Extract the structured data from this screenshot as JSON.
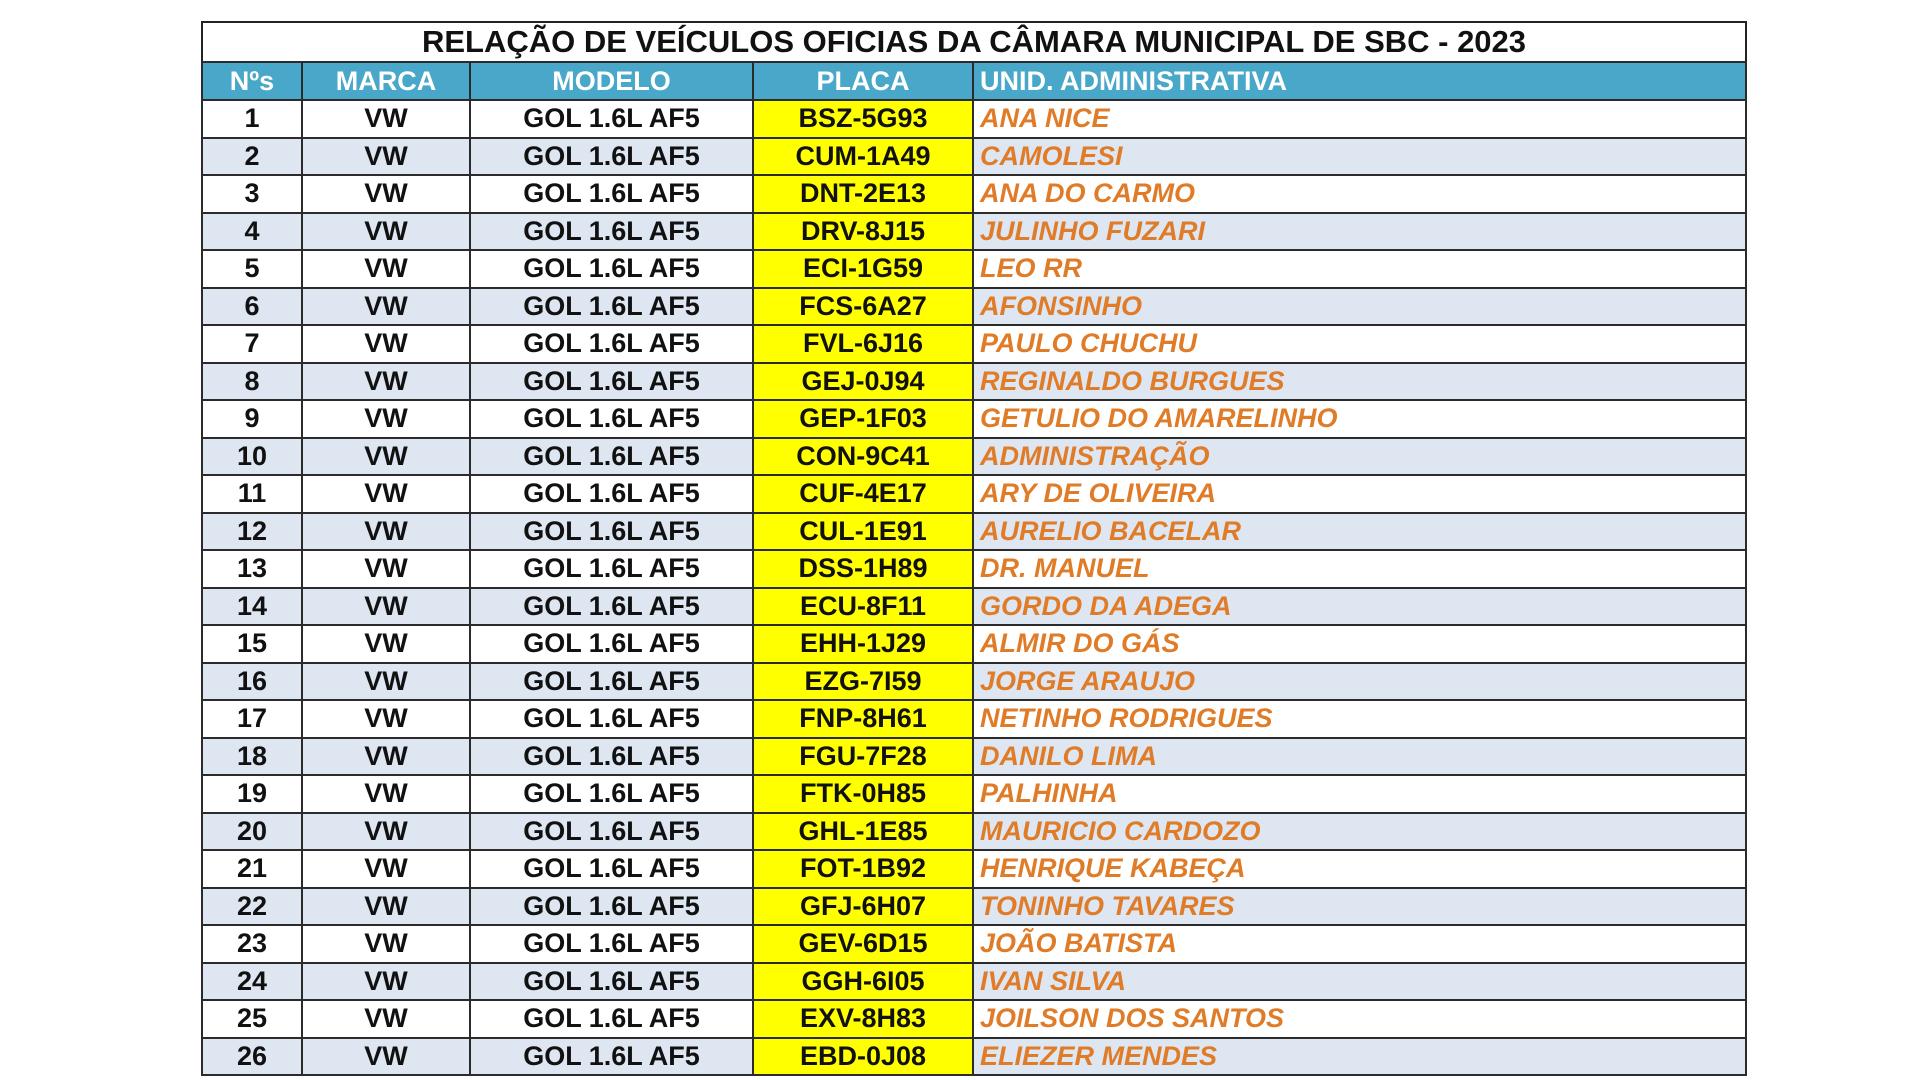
{
  "document": {
    "title": "RELAÇÃO DE VEÍCULOS OFICIAS DA CÂMARA MUNICIPAL DE SBC - 2023"
  },
  "colors": {
    "header_bg": "#49a8c9",
    "header_text": "#ffffff",
    "plate_bg": "#ffff00",
    "unit_text": "#e07b27",
    "alt_row_bg": "#dde6f1",
    "border": "#2b2b2b"
  },
  "table": {
    "columns": [
      "Nºs",
      "MARCA",
      "MODELO",
      "PLACA",
      "UNID. ADMINISTRATIVA"
    ],
    "rows": [
      {
        "num": "1",
        "marca": "VW",
        "modelo": "GOL 1.6L AF5",
        "placa": "BSZ-5G93",
        "unidade": "ANA NICE"
      },
      {
        "num": "2",
        "marca": "VW",
        "modelo": "GOL 1.6L AF5",
        "placa": "CUM-1A49",
        "unidade": "CAMOLESI"
      },
      {
        "num": "3",
        "marca": "VW",
        "modelo": "GOL 1.6L AF5",
        "placa": "DNT-2E13",
        "unidade": "ANA DO CARMO"
      },
      {
        "num": "4",
        "marca": "VW",
        "modelo": "GOL 1.6L AF5",
        "placa": "DRV-8J15",
        "unidade": "JULINHO FUZARI"
      },
      {
        "num": "5",
        "marca": "VW",
        "modelo": "GOL 1.6L AF5",
        "placa": "ECI-1G59",
        "unidade": "LEO RR"
      },
      {
        "num": "6",
        "marca": "VW",
        "modelo": "GOL 1.6L AF5",
        "placa": "FCS-6A27",
        "unidade": "AFONSINHO"
      },
      {
        "num": "7",
        "marca": "VW",
        "modelo": "GOL 1.6L AF5",
        "placa": "FVL-6J16",
        "unidade": "PAULO CHUCHU"
      },
      {
        "num": "8",
        "marca": "VW",
        "modelo": "GOL 1.6L AF5",
        "placa": "GEJ-0J94",
        "unidade": "REGINALDO BURGUES"
      },
      {
        "num": "9",
        "marca": "VW",
        "modelo": "GOL 1.6L AF5",
        "placa": "GEP-1F03",
        "unidade": "GETULIO DO AMARELINHO"
      },
      {
        "num": "10",
        "marca": "VW",
        "modelo": "GOL 1.6L AF5",
        "placa": "CON-9C41",
        "unidade": "ADMINISTRAÇÃO"
      },
      {
        "num": "11",
        "marca": "VW",
        "modelo": "GOL 1.6L AF5",
        "placa": "CUF-4E17",
        "unidade": "ARY DE OLIVEIRA"
      },
      {
        "num": "12",
        "marca": "VW",
        "modelo": "GOL 1.6L AF5",
        "placa": "CUL-1E91",
        "unidade": "AURELIO BACELAR"
      },
      {
        "num": "13",
        "marca": "VW",
        "modelo": "GOL 1.6L AF5",
        "placa": "DSS-1H89",
        "unidade": "DR. MANUEL"
      },
      {
        "num": "14",
        "marca": "VW",
        "modelo": "GOL 1.6L AF5",
        "placa": "ECU-8F11",
        "unidade": "GORDO DA ADEGA"
      },
      {
        "num": "15",
        "marca": "VW",
        "modelo": "GOL 1.6L AF5",
        "placa": "EHH-1J29",
        "unidade": "ALMIR DO GÁS"
      },
      {
        "num": "16",
        "marca": "VW",
        "modelo": "GOL 1.6L AF5",
        "placa": "EZG-7I59",
        "unidade": "JORGE ARAUJO"
      },
      {
        "num": "17",
        "marca": "VW",
        "modelo": "GOL 1.6L AF5",
        "placa": "FNP-8H61",
        "unidade": "NETINHO RODRIGUES"
      },
      {
        "num": "18",
        "marca": "VW",
        "modelo": "GOL 1.6L AF5",
        "placa": "FGU-7F28",
        "unidade": "DANILO LIMA"
      },
      {
        "num": "19",
        "marca": "VW",
        "modelo": "GOL 1.6L AF5",
        "placa": "FTK-0H85",
        "unidade": "PALHINHA"
      },
      {
        "num": "20",
        "marca": "VW",
        "modelo": "GOL 1.6L AF5",
        "placa": "GHL-1E85",
        "unidade": "MAURICIO CARDOZO"
      },
      {
        "num": "21",
        "marca": "VW",
        "modelo": "GOL 1.6L AF5",
        "placa": "FOT-1B92",
        "unidade": "HENRIQUE KABEÇA"
      },
      {
        "num": "22",
        "marca": "VW",
        "modelo": "GOL 1.6L AF5",
        "placa": "GFJ-6H07",
        "unidade": "TONINHO TAVARES"
      },
      {
        "num": "23",
        "marca": "VW",
        "modelo": "GOL 1.6L AF5",
        "placa": "GEV-6D15",
        "unidade": "JOÃO BATISTA"
      },
      {
        "num": "24",
        "marca": "VW",
        "modelo": "GOL 1.6L AF5",
        "placa": "GGH-6I05",
        "unidade": "IVAN SILVA"
      },
      {
        "num": "25",
        "marca": "VW",
        "modelo": "GOL 1.6L AF5",
        "placa": "EXV-8H83",
        "unidade": "JOILSON DOS SANTOS"
      },
      {
        "num": "26",
        "marca": "VW",
        "modelo": "GOL 1.6L AF5",
        "placa": "EBD-0J08",
        "unidade": "ELIEZER MENDES"
      }
    ]
  }
}
